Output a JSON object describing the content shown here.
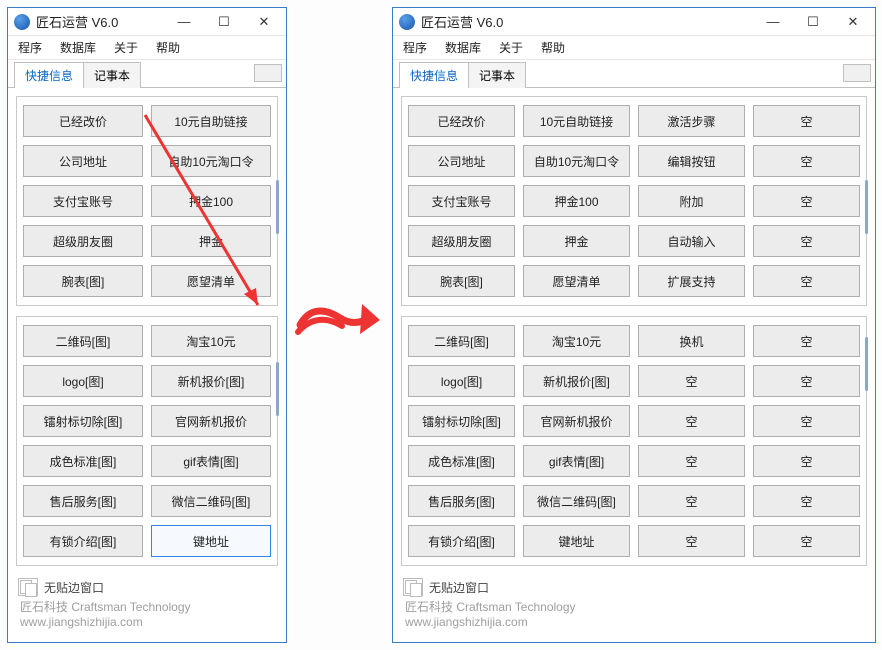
{
  "app": {
    "title": "匠石运营 V6.0",
    "menus": [
      "程序",
      "数据库",
      "关于",
      "帮助"
    ],
    "tabs": {
      "t1": "快捷信息",
      "t2": "记事本"
    }
  },
  "left": {
    "group1": [
      [
        "已经改价",
        "10元自助链接"
      ],
      [
        "公司地址",
        "自助10元淘口令"
      ],
      [
        "支付宝账号",
        "押金100"
      ],
      [
        "超级朋友圈",
        "押金"
      ],
      [
        "腕表[图]",
        "愿望清单"
      ]
    ],
    "group2": [
      [
        "二维码[图]",
        "淘宝10元"
      ],
      [
        "logo[图]",
        "新机报价[图]"
      ],
      [
        "镭射标切除[图]",
        "官网新机报价"
      ],
      [
        "成色标准[图]",
        "gif表情[图]"
      ],
      [
        "售后服务[图]",
        "微信二维码[图]"
      ],
      [
        "有锁介绍[图]",
        "键地址"
      ]
    ],
    "highlighted": "键地址"
  },
  "right": {
    "group1": [
      [
        "已经改价",
        "10元自助链接",
        "激活步骤",
        "空"
      ],
      [
        "公司地址",
        "自助10元淘口令",
        "编辑按钮",
        "空"
      ],
      [
        "支付宝账号",
        "押金100",
        "附加",
        "空"
      ],
      [
        "超级朋友圈",
        "押金",
        "自动输入",
        "空"
      ],
      [
        "腕表[图]",
        "愿望清单",
        "扩展支持",
        "空"
      ]
    ],
    "group2": [
      [
        "二维码[图]",
        "淘宝10元",
        "换机",
        "空"
      ],
      [
        "logo[图]",
        "新机报价[图]",
        "空",
        "空"
      ],
      [
        "镭射标切除[图]",
        "官网新机报价",
        "空",
        "空"
      ],
      [
        "成色标准[图]",
        "gif表情[图]",
        "空",
        "空"
      ],
      [
        "售后服务[图]",
        "微信二维码[图]",
        "空",
        "空"
      ],
      [
        "有锁介绍[图]",
        "键地址",
        "空",
        "空"
      ]
    ]
  },
  "footer": {
    "label": "无贴边窗口",
    "line1": "匠石科技 Craftsman Technology",
    "line2": "www.jiangshizhijia.com"
  },
  "win_controls": {
    "min": "—",
    "max": "☐",
    "close": "✕"
  }
}
